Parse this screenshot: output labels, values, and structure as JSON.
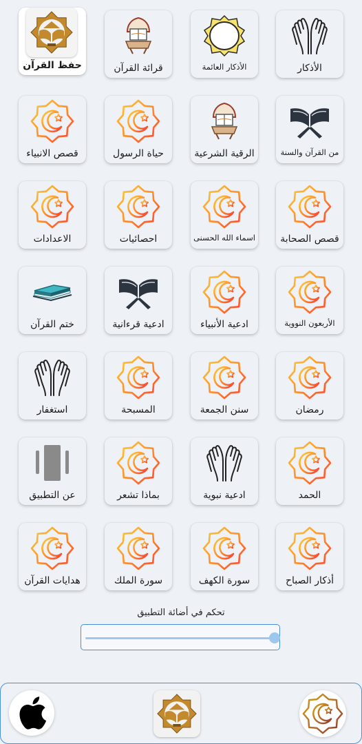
{
  "tiles": [
    {
      "label": "الأذكار",
      "icon": "praying-hands-icon"
    },
    {
      "label": "الأذكار العائمة",
      "icon": "ornamental-frame-icon"
    },
    {
      "label": "قرائة القرآن",
      "icon": "quran-stand-icon"
    },
    {
      "label": "حفظ القرآن",
      "icon": "quran-memorization-logo-icon"
    },
    {
      "label": "من القرآن والسنة",
      "icon": "open-quran-icon"
    },
    {
      "label": "الرقية الشرعية",
      "icon": "quran-stand-icon"
    },
    {
      "label": "حياة الرسول",
      "icon": "crescent-star-icon"
    },
    {
      "label": "قصص الانبياء",
      "icon": "crescent-star-icon"
    },
    {
      "label": "قصص الصحابة",
      "icon": "crescent-star-icon"
    },
    {
      "label": "اسماء الله الحسنى",
      "icon": "crescent-star-icon"
    },
    {
      "label": "احصائيات",
      "icon": "crescent-star-icon"
    },
    {
      "label": "الاعدادات",
      "icon": "crescent-star-icon"
    },
    {
      "label": "الأربعون النووية",
      "icon": "crescent-star-icon"
    },
    {
      "label": "ادعية الأنبياء",
      "icon": "crescent-star-icon"
    },
    {
      "label": "ادعية قرءانية",
      "icon": "open-quran-icon"
    },
    {
      "label": "ختم القرآن",
      "icon": "closed-quran-icon"
    },
    {
      "label": "رمضان",
      "icon": "crescent-star-icon"
    },
    {
      "label": "سنن الجمعة",
      "icon": "crescent-star-icon"
    },
    {
      "label": "المسبحة",
      "icon": "crescent-star-icon"
    },
    {
      "label": "استغفار",
      "icon": "praying-hands-icon"
    },
    {
      "label": "الحمد",
      "icon": "crescent-star-icon"
    },
    {
      "label": "ادعية نبوية",
      "icon": "praying-hands-icon"
    },
    {
      "label": "بماذا تشعر",
      "icon": "crescent-star-icon"
    },
    {
      "label": "عن التطبيق",
      "icon": "app-info-icon"
    },
    {
      "label": "أذكار الصباح",
      "icon": "crescent-star-icon"
    },
    {
      "label": "سورة الكهف",
      "icon": "crescent-star-icon"
    },
    {
      "label": "سورة الملك",
      "icon": "crescent-star-icon"
    },
    {
      "label": "هدايات القرآن",
      "icon": "crescent-star-icon"
    }
  ],
  "brightness": {
    "title": "تحكم في أضائة التطبيق",
    "value": 1.0
  },
  "bottom_bar": {
    "left_icon": "apple-logo-icon",
    "center_icon": "quran-memorization-logo-icon",
    "right_icon": "crescent-star-gold-icon"
  },
  "colors": {
    "background": "#eef1f5",
    "accent_blue": "#4a90d9",
    "slider_fill": "#9ec7ee",
    "crescent_gradient_top": "#ffcc33",
    "crescent_gradient_bottom": "#ff3b30"
  }
}
